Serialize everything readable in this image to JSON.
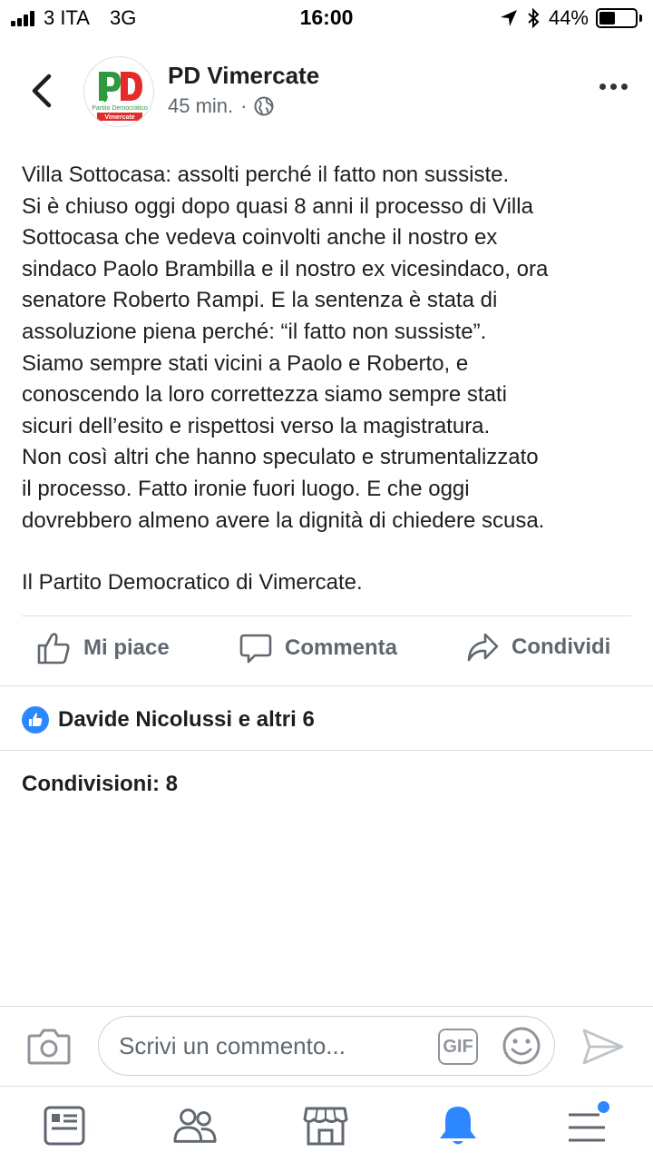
{
  "status_bar": {
    "carrier": "3 ITA",
    "network": "3G",
    "time": "16:00",
    "battery": "44%",
    "battery_level": 0.44
  },
  "post": {
    "page_name": "PD Vimercate",
    "time_ago": "45 min.",
    "meta_separator": "·",
    "avatar_text": "PD",
    "avatar_logo_caption": "Partito Democratico",
    "avatar_location": "Vimercate",
    "body_lines": [
      "Villa Sottocasa: assolti perché il fatto non sussiste.",
      "Si è chiuso oggi dopo quasi 8 anni il processo di Villa",
      "Sottocasa che vedeva coinvolti anche il nostro ex",
      "sindaco Paolo Brambilla e il nostro ex vicesindaco, ora",
      "senatore Roberto Rampi. E la sentenza è stata di",
      "assoluzione piena perché: “il fatto non sussiste”.",
      "Siamo sempre stati vicini a Paolo e Roberto, e",
      "conoscendo la loro correttezza siamo sempre stati",
      "sicuri dell’esito e rispettosi verso la magistratura.",
      "Non così altri che hanno speculato e strumentalizzato",
      "il processo. Fatto ironie fuori luogo. E che oggi",
      "dovrebbero almeno avere la dignità di chiedere scusa."
    ],
    "signature": "Il Partito Democratico di Vimercate."
  },
  "actions": {
    "like": "Mi piace",
    "comment": "Commenta",
    "share": "Condividi"
  },
  "reactions": {
    "text": "Davide Nicolussi e altri 6"
  },
  "shares": {
    "text": "Condivisioni: 8"
  },
  "comment_bar": {
    "placeholder": "Scrivi un commento...",
    "gif_label": "GIF"
  },
  "tab_bar": {
    "tabs": [
      "news-feed-icon",
      "friends-icon",
      "marketplace-icon",
      "notifications-icon",
      "menu-icon"
    ],
    "active": "notifications-icon"
  },
  "colors": {
    "accent": "#2d88ff",
    "text": "#1c1e21",
    "secondary": "#606770",
    "pd_green": "#2e9a3e",
    "pd_red": "#e32b2b"
  }
}
